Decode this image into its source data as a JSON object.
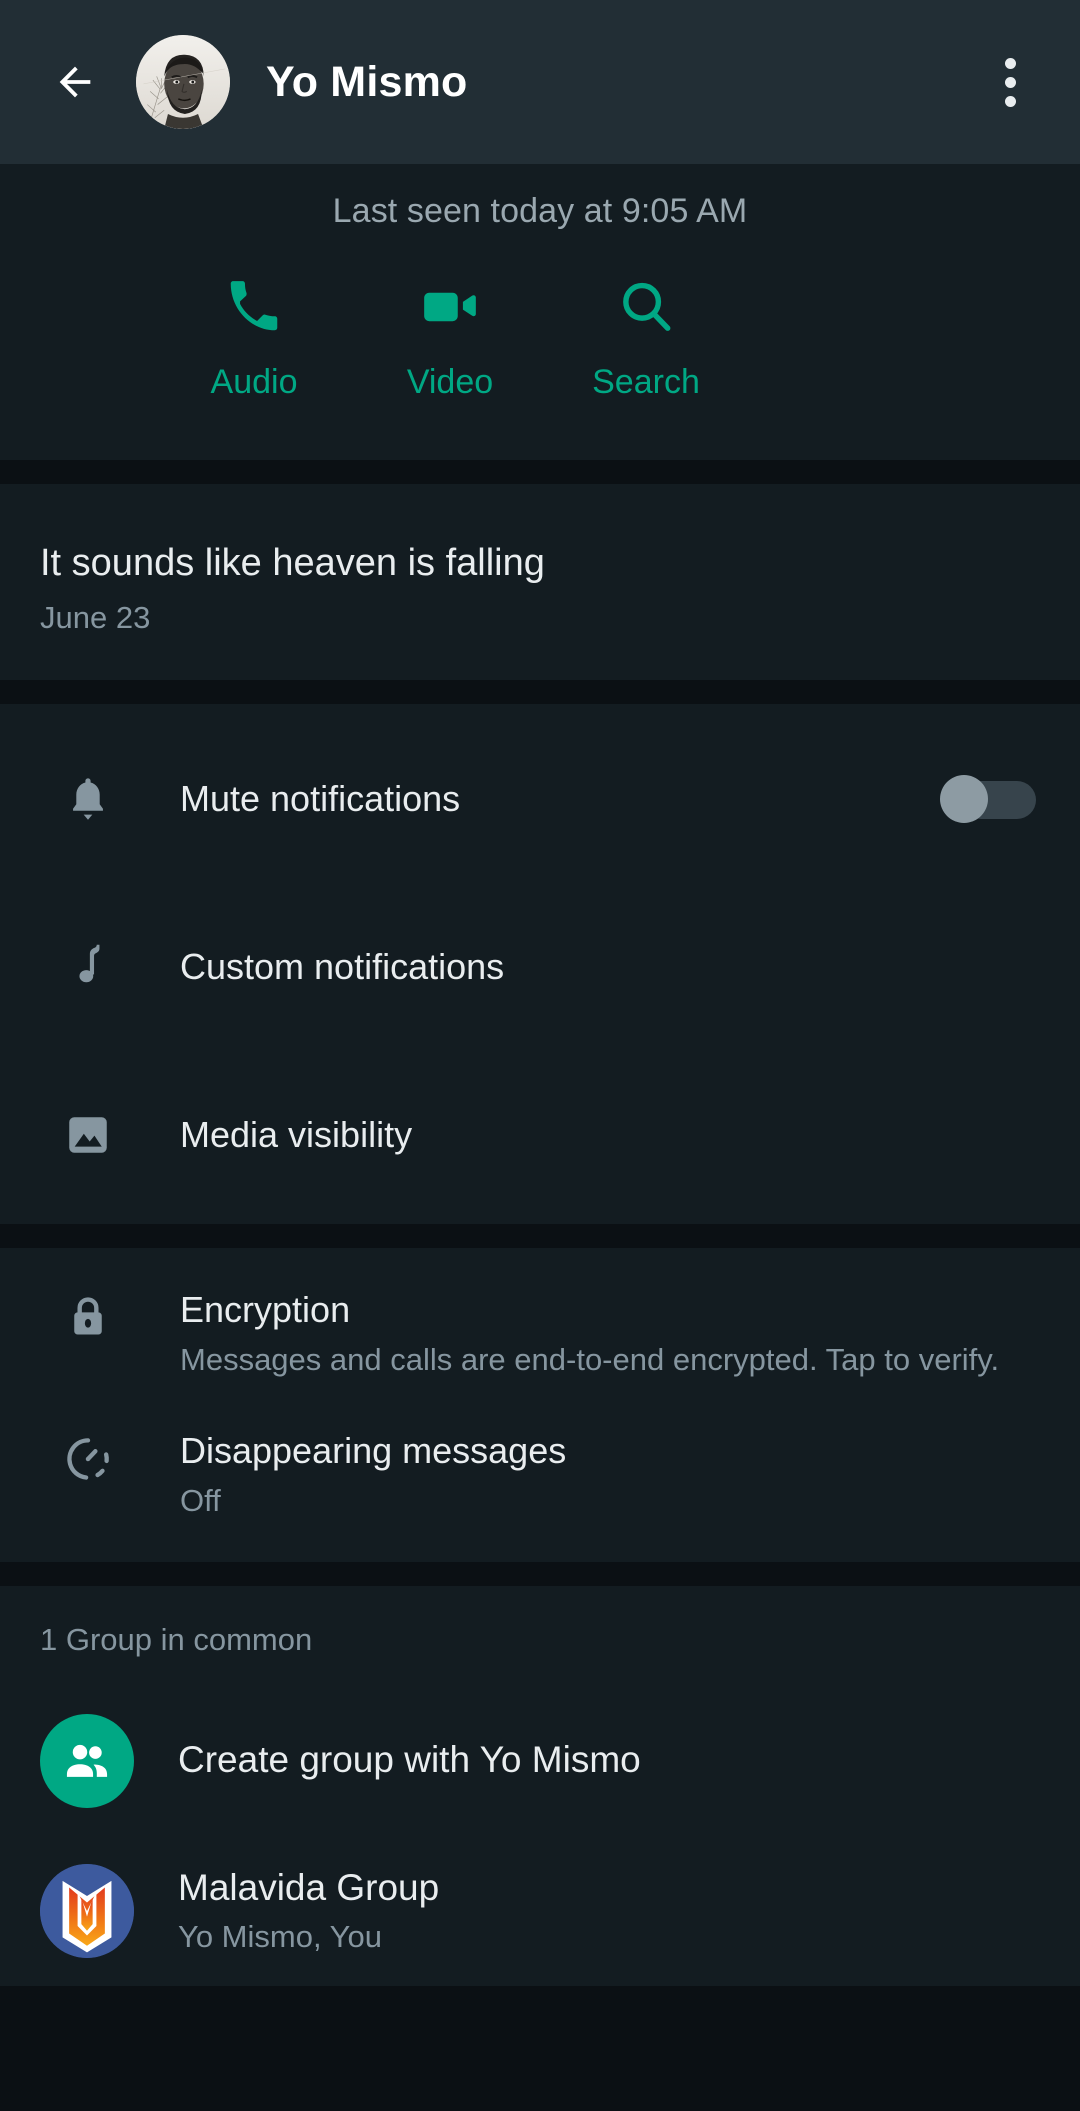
{
  "header": {
    "back_icon": "arrow-left-icon",
    "avatar_alt": "contact-avatar",
    "title": "Yo Mismo",
    "overflow_icon": "more-vertical-icon"
  },
  "status": {
    "last_seen": "Last seen today at 9:05 AM"
  },
  "quick_actions": [
    {
      "icon": "phone-icon",
      "label": "Audio"
    },
    {
      "icon": "video-camera-icon",
      "label": "Video"
    },
    {
      "icon": "search-icon",
      "label": "Search"
    }
  ],
  "about": {
    "text": "It sounds like heaven is falling",
    "date": "June 23"
  },
  "settings": [
    {
      "icon": "bell-icon",
      "label": "Mute notifications",
      "control": "toggle",
      "toggle_on": false
    },
    {
      "icon": "music-note-icon",
      "label": "Custom notifications"
    },
    {
      "icon": "image-icon",
      "label": "Media visibility"
    }
  ],
  "privacy": [
    {
      "icon": "lock-icon",
      "label": "Encryption",
      "sub": "Messages and calls are end-to-end encrypted. Tap to verify."
    },
    {
      "icon": "timer-icon",
      "label": "Disappearing messages",
      "sub": "Off"
    }
  ],
  "groups": {
    "heading": "1 Group in common",
    "items": [
      {
        "avatar": "create-group-icon",
        "name": "Create group with Yo Mismo",
        "sub": ""
      },
      {
        "avatar": "malavida-logo",
        "name": "Malavida Group",
        "sub": "Yo Mismo, You"
      }
    ]
  },
  "colors": {
    "accent": "#00a884",
    "appbar": "#222e35",
    "surface": "#131c21",
    "background": "#0b1014",
    "primary_text": "#e9edef",
    "secondary_text": "#8696a0",
    "toggle_track": "#37444c",
    "toggle_knob": "#8d9ba3"
  }
}
